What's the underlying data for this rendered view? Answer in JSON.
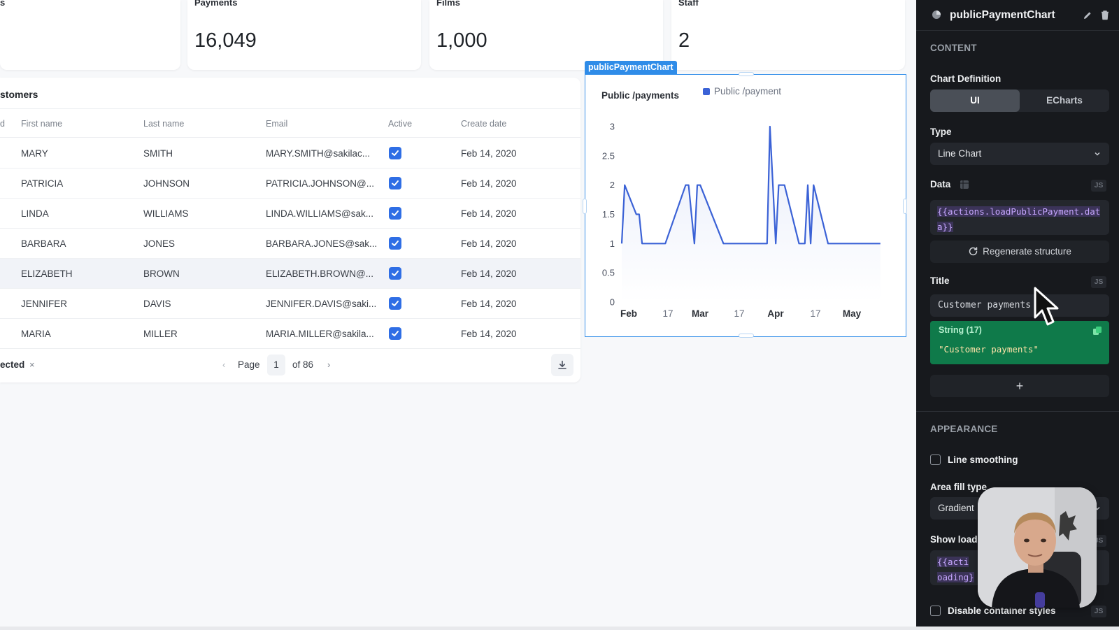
{
  "stats": [
    {
      "label": "s",
      "value": ""
    },
    {
      "label": "Payments",
      "value": "16,049"
    },
    {
      "label": "Films",
      "value": "1,000"
    },
    {
      "label": "Staff",
      "value": "2"
    }
  ],
  "table": {
    "title": "stomers",
    "columns": [
      "d",
      "First name",
      "Last name",
      "Email",
      "Active",
      "Create date"
    ],
    "rows": [
      {
        "first": "MARY",
        "last": "SMITH",
        "email": "MARY.SMITH@sakilac...",
        "active": true,
        "date": "Feb 14, 2020"
      },
      {
        "first": "PATRICIA",
        "last": "JOHNSON",
        "email": "PATRICIA.JOHNSON@...",
        "active": true,
        "date": "Feb 14, 2020"
      },
      {
        "first": "LINDA",
        "last": "WILLIAMS",
        "email": "LINDA.WILLIAMS@sak...",
        "active": true,
        "date": "Feb 14, 2020"
      },
      {
        "first": "BARBARA",
        "last": "JONES",
        "email": "BARBARA.JONES@sak...",
        "active": true,
        "date": "Feb 14, 2020"
      },
      {
        "first": "ELIZABETH",
        "last": "BROWN",
        "email": "ELIZABETH.BROWN@...",
        "active": true,
        "date": "Feb 14, 2020"
      },
      {
        "first": "JENNIFER",
        "last": "DAVIS",
        "email": "JENNIFER.DAVIS@saki...",
        "active": true,
        "date": "Feb 14, 2020"
      },
      {
        "first": "MARIA",
        "last": "MILLER",
        "email": "MARIA.MILLER@sakila...",
        "active": true,
        "date": "Feb 14, 2020"
      }
    ],
    "footer": {
      "selected": "ected",
      "clear": "×",
      "prev": "‹",
      "page_label": "Page",
      "page": "1",
      "of": "of 86",
      "next": "›"
    }
  },
  "chart_widget": {
    "tag": "publicPaymentChart",
    "title": "Public /payments",
    "legend": "Public /payment"
  },
  "chart_data": {
    "type": "area",
    "title": "Public /payments",
    "legend": [
      "Public /payment"
    ],
    "series": [
      {
        "name": "Public /payment",
        "color": "#3b62d6",
        "x": [
          "2007-02-14",
          "2007-02-15",
          "2007-02-19",
          "2007-02-20",
          "2007-02-21",
          "2007-03-01",
          "2007-03-08",
          "2007-03-09",
          "2007-03-10",
          "2007-03-11",
          "2007-03-12",
          "2007-03-13",
          "2007-03-21",
          "2007-03-22",
          "2007-03-23",
          "2007-03-24",
          "2007-04-05",
          "2007-04-06",
          "2007-04-07",
          "2007-04-08",
          "2007-04-09",
          "2007-04-10",
          "2007-04-11",
          "2007-04-16",
          "2007-04-17",
          "2007-04-18",
          "2007-04-19",
          "2007-04-20",
          "2007-04-21",
          "2007-04-26",
          "2007-05-04",
          "2007-05-14"
        ],
        "y": [
          1,
          2,
          1.5,
          1.5,
          1,
          1,
          2,
          2,
          1.5,
          1,
          2,
          2,
          1,
          1,
          1,
          1,
          1,
          3,
          2,
          1,
          2,
          2,
          2,
          1,
          1,
          1,
          2,
          1,
          2,
          1,
          1,
          1
        ]
      }
    ],
    "xticks": [
      "Feb",
      "17",
      "Mar",
      "17",
      "Apr",
      "17",
      "May"
    ],
    "yticks": [
      "0",
      "0.5",
      "1",
      "1.5",
      "2",
      "2.5",
      "3"
    ],
    "ylim": [
      0,
      3
    ],
    "area_fill": "gradient",
    "grid": false,
    "legend_position": "top"
  },
  "panel": {
    "title": "publicPaymentChart",
    "content_label": "CONTENT",
    "chart_def_label": "Chart Definition",
    "seg_ui": "UI",
    "seg_echarts": "ECharts",
    "type_label": "Type",
    "type_value": "Line Chart",
    "data_label": "Data",
    "js": "JS",
    "data_code": "{{actions.loadPublicPayment.data}}",
    "regen_label": "Regenerate structure",
    "title_label": "Title",
    "title_value": "Customer payments",
    "tip_type": "String (17)",
    "tip_value": "\"Customer payments\"",
    "add_label": "+",
    "appearance_label": "APPEARANCE",
    "line_smoothing_label": "Line smoothing",
    "area_fill_label": "Area fill type",
    "area_fill_value": "Gradient",
    "show_loading_label": "Show load",
    "loading_code_line1": "{{acti",
    "loading_code_line2": "oading}",
    "disable_label": "Disable container styles"
  },
  "colors": {
    "accent": "#2f6ee5",
    "chart_line": "#3b62d6",
    "selection": "#3b93ea",
    "panel_bg": "#17191d",
    "tooltip_bg": "#0f7a4a"
  }
}
